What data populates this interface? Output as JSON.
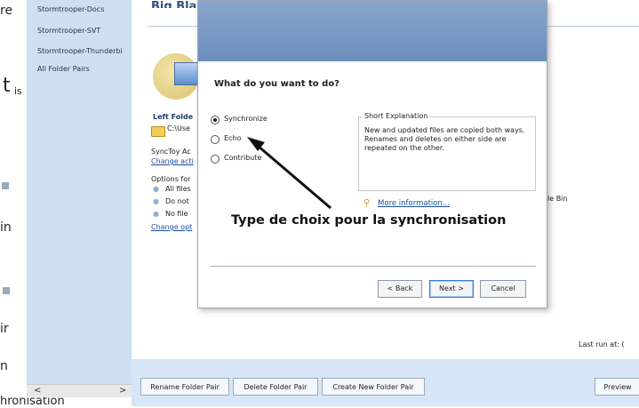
{
  "left_strip": {
    "fragments": [
      "re",
      "t",
      "is",
      "in",
      "ir",
      "n"
    ],
    "bottom_text": "hronisation"
  },
  "sidebar": {
    "items": [
      {
        "label": "Stormtrooper-Docs"
      },
      {
        "label": "Stormtrooper-SVT"
      },
      {
        "label": "Stormtrooper-Thunderbi"
      },
      {
        "label": "All Folder Pairs"
      }
    ],
    "scroll_left": "<",
    "scroll_right": ">"
  },
  "main": {
    "title": "Big Bla",
    "left_folder_label": "Left Folde",
    "left_folder_path": "C:\\Use",
    "synctoy_action": "SyncToy Ac",
    "change_action": "Change acti",
    "options_label": "Options for",
    "options": [
      "All files",
      "Do not",
      "No file"
    ],
    "change_options": "Change opt",
    "recycle_fragment": "le Bin",
    "last_run": "Last run at: ("
  },
  "toolbar": {
    "rename": "Rename Folder Pair",
    "delete": "Delete Folder Pair",
    "create": "Create New Folder Pair",
    "preview": "Preview"
  },
  "dialog": {
    "question": "What do you want to do?",
    "options": [
      {
        "label": "Synchronize",
        "checked": true
      },
      {
        "label": "Echo",
        "checked": false
      },
      {
        "label": "Contribute",
        "checked": false
      }
    ],
    "explanation_title": "Short Explanation",
    "explanation_text": "New and updated files are copied both ways. Renames and deletes on either side are repeated on the other.",
    "more_info": "More information...",
    "back_button": "< Back",
    "next_button": "Next >",
    "cancel_button": "Cancel"
  },
  "annotation": "Type de choix pour la synchronisation"
}
